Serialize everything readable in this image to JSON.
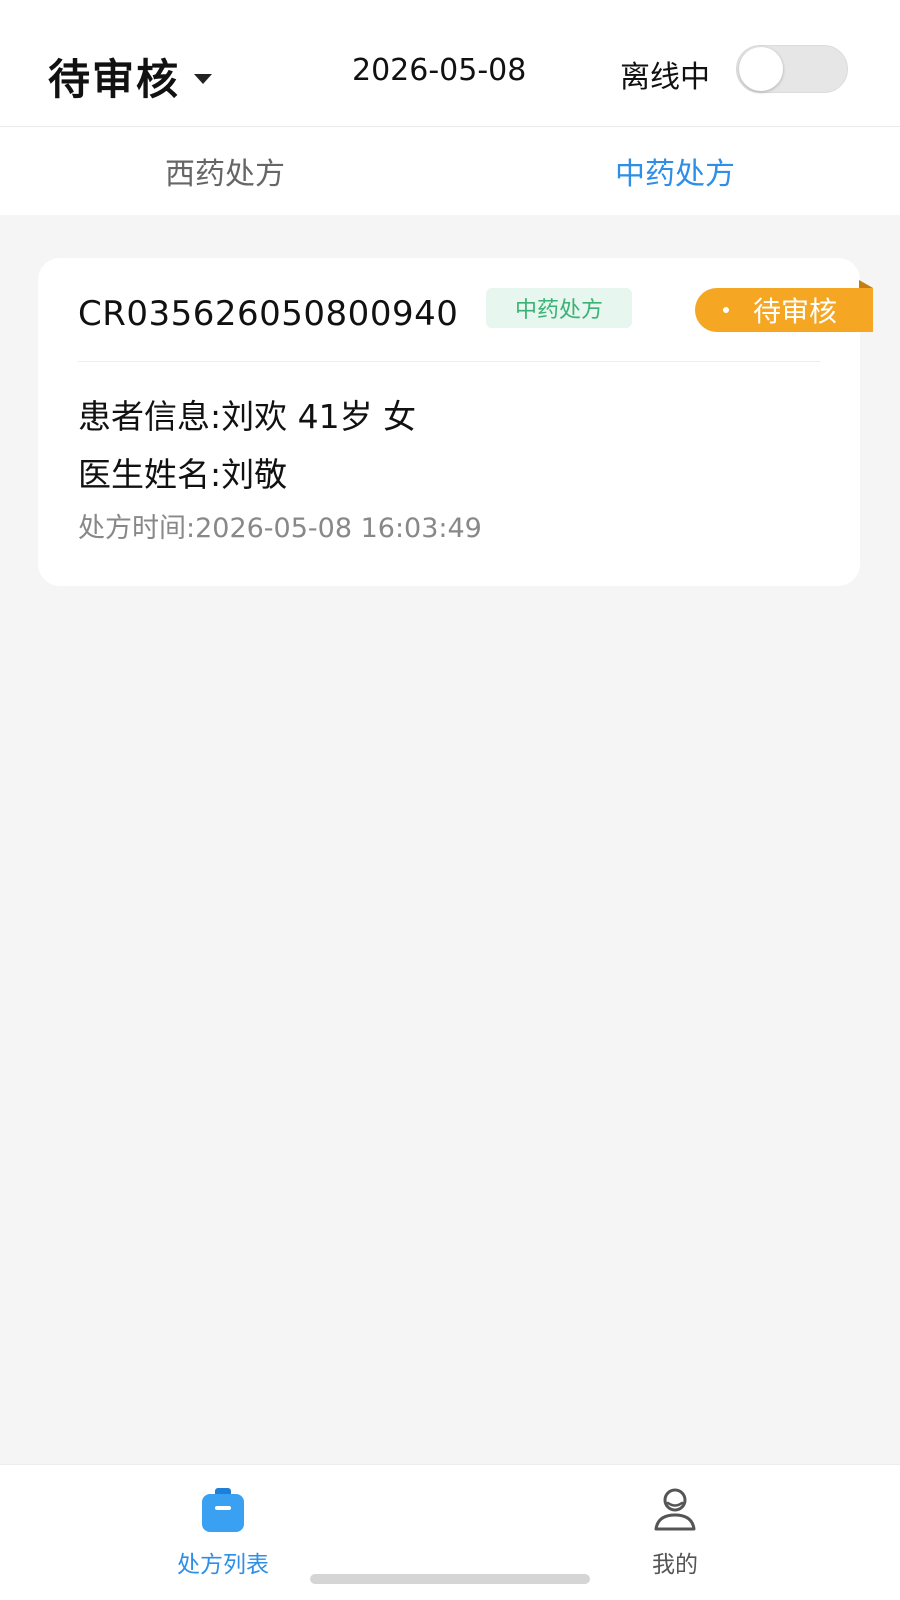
{
  "header": {
    "status_title": "待审核",
    "date": "2026-05-08",
    "offline_label": "离线中",
    "offline_toggle_on": false
  },
  "tabs": [
    {
      "label": "西药处方",
      "active": false
    },
    {
      "label": "中药处方",
      "active": true
    }
  ],
  "prescription": {
    "number": "CR035626050800940",
    "type_badge": "中药处方",
    "status": "待审核",
    "patient_info": "患者信息:刘欢 41岁 女",
    "doctor_name": "医生姓名:刘敬",
    "time": "处方时间:2026-05-08 16:03:49"
  },
  "bottom_nav": [
    {
      "label": "处方列表",
      "icon": "clipboard-list-icon",
      "active": true
    },
    {
      "label": "我的",
      "icon": "user-icon",
      "active": false
    }
  ],
  "colors": {
    "accent_blue": "#2f8ee6",
    "pending_orange": "#f5a623",
    "badge_green_text": "#3bb276",
    "badge_green_bg": "#e7f6ee",
    "background": "#f5f5f6"
  }
}
